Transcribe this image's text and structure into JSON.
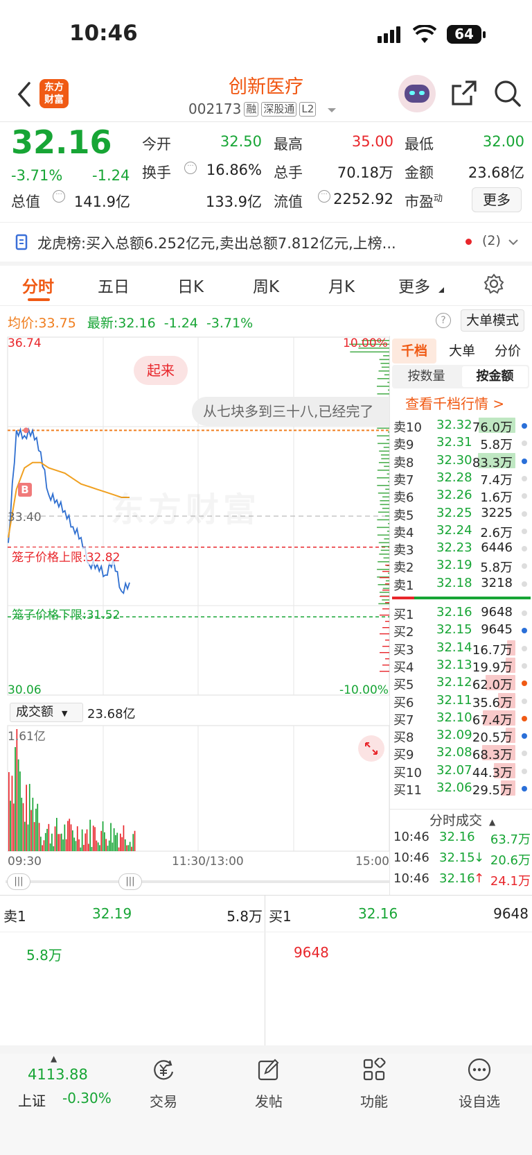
{
  "status": {
    "time": "10:46",
    "battery": "64"
  },
  "header": {
    "title": "创新医疗",
    "code": "002173",
    "tags": [
      "融",
      "深股通",
      "L2"
    ],
    "logo_line1": "东方",
    "logo_line2": "财富"
  },
  "quote": {
    "price": "32.16",
    "change_pct": "-3.71%",
    "change": "-1.24",
    "fields": [
      {
        "label": "今开",
        "value": "32.50",
        "color": "#17a535"
      },
      {
        "label": "最高",
        "value": "35.00",
        "color": "#e8262b"
      },
      {
        "label": "最低",
        "value": "32.00",
        "color": "#17a535"
      },
      {
        "label": "换手",
        "value": "16.86%",
        "color": "#222"
      },
      {
        "label": "总手",
        "value": "70.18万",
        "color": "#222"
      },
      {
        "label": "金额",
        "value": "23.68亿",
        "color": "#222"
      },
      {
        "label": "总值",
        "value": "141.9亿",
        "color": "#222"
      },
      {
        "label": "流值",
        "value": "133.9亿",
        "color": "#222"
      },
      {
        "label": "市盈",
        "value": "2252.92",
        "color": "#222"
      }
    ],
    "pe_sup": "动",
    "more": "更多"
  },
  "notice": {
    "label": "龙虎榜:",
    "text": "买入总额6.252亿元,卖出总额7.812亿元,上榜...",
    "count": "(2)"
  },
  "tabs": [
    "分时",
    "五日",
    "日K",
    "周K",
    "月K",
    "更多"
  ],
  "info_line": {
    "avg_label": "均价:",
    "avg": "33.75",
    "latest_label": "最新:",
    "latest": "32.16",
    "chg": "-1.24",
    "pct": "-3.71%",
    "bigorder": "大单模式"
  },
  "chart": {
    "y_top": "36.74",
    "y_mid": "33.40",
    "y_bottom": "30.06",
    "pct_top": "10.00%",
    "pct_bottom": "-10.00%",
    "upper_limit_label": "笼子价格上限:",
    "upper_limit": "32.82",
    "lower_limit_label": "笼子价格下限:",
    "lower_limit": "31.52",
    "bubble": "起来",
    "comment": "从七块多到三十八,已经完了",
    "watermark": "东方财富",
    "buy_marker": "B",
    "vol_label": "成交额",
    "vol_value": "23.68亿",
    "vol_max": "1.61亿",
    "x_start": "09:30",
    "x_mid": "11:30/13:00",
    "x_end": "15:00"
  },
  "chart_data": {
    "type": "line",
    "x": [
      "09:30",
      "09:35",
      "09:40",
      "09:45",
      "09:50",
      "09:55",
      "10:00",
      "10:05",
      "10:10",
      "10:15",
      "10:20",
      "10:25",
      "10:30",
      "10:35",
      "10:40",
      "10:46"
    ],
    "series": [
      {
        "values": [
          32.9,
          35.0,
          34.9,
          35.0,
          34.6,
          33.8,
          33.7,
          33.5,
          33.2,
          33.0,
          32.5,
          32.5,
          32.3,
          32.6,
          32.0,
          32.16
        ]
      },
      {
        "values": [
          33.0,
          33.9,
          34.3,
          34.4,
          34.4,
          34.3,
          34.25,
          34.2,
          34.1,
          34.0,
          33.95,
          33.9,
          33.85,
          33.8,
          33.75,
          33.75
        ]
      }
    ],
    "ylim": [
      30.06,
      36.74
    ]
  },
  "orderbook": {
    "tabs": [
      "千档",
      "大单",
      "分价"
    ],
    "subtabs": [
      "按数量",
      "按金额"
    ],
    "link": "查看千档行情 >",
    "asks": [
      {
        "l": "卖10",
        "p": "32.32",
        "v": "76.0万"
      },
      {
        "l": "卖9",
        "p": "32.31",
        "v": "5.8万"
      },
      {
        "l": "卖8",
        "p": "32.30",
        "v": "83.3万"
      },
      {
        "l": "卖7",
        "p": "32.28",
        "v": "7.4万"
      },
      {
        "l": "卖6",
        "p": "32.26",
        "v": "1.6万"
      },
      {
        "l": "卖5",
        "p": "32.25",
        "v": "3225"
      },
      {
        "l": "卖4",
        "p": "32.24",
        "v": "2.6万"
      },
      {
        "l": "卖3",
        "p": "32.23",
        "v": "6446"
      },
      {
        "l": "卖2",
        "p": "32.19",
        "v": "5.8万"
      },
      {
        "l": "卖1",
        "p": "32.18",
        "v": "3218"
      }
    ],
    "bids": [
      {
        "l": "买1",
        "p": "32.16",
        "v": "9648"
      },
      {
        "l": "买2",
        "p": "32.15",
        "v": "9645"
      },
      {
        "l": "买3",
        "p": "32.14",
        "v": "16.7万"
      },
      {
        "l": "买4",
        "p": "32.13",
        "v": "19.9万"
      },
      {
        "l": "买5",
        "p": "32.12",
        "v": "62.0万"
      },
      {
        "l": "买6",
        "p": "32.11",
        "v": "35.6万"
      },
      {
        "l": "买7",
        "p": "32.10",
        "v": "67.4万"
      },
      {
        "l": "买8",
        "p": "32.09",
        "v": "20.5万"
      },
      {
        "l": "买9",
        "p": "32.08",
        "v": "68.3万"
      },
      {
        "l": "买10",
        "p": "32.07",
        "v": "44.3万"
      },
      {
        "l": "买11",
        "p": "32.06",
        "v": "29.5万"
      }
    ],
    "ticks_title": "分时成交",
    "ticks": [
      {
        "t": "10:46",
        "p": "32.16",
        "v": "63.7万",
        "a": ""
      },
      {
        "t": "10:46",
        "p": "32.15",
        "v": "20.6万",
        "a": "↓"
      },
      {
        "t": "10:46",
        "p": "32.16",
        "v": "24.1万",
        "a": "↑"
      }
    ]
  },
  "bottom_quote": {
    "ask_label": "卖1",
    "ask_price": "32.19",
    "ask_vol": "5.8万",
    "ask_sub": "5.8万",
    "bid_label": "买1",
    "bid_price": "32.16",
    "bid_vol": "9648",
    "bid_sub": "9648"
  },
  "tabbar": {
    "index_value": "4113.88",
    "index_name": "上证",
    "index_pct": "-0.30%",
    "items": [
      "交易",
      "发帖",
      "功能",
      "设自选"
    ]
  }
}
